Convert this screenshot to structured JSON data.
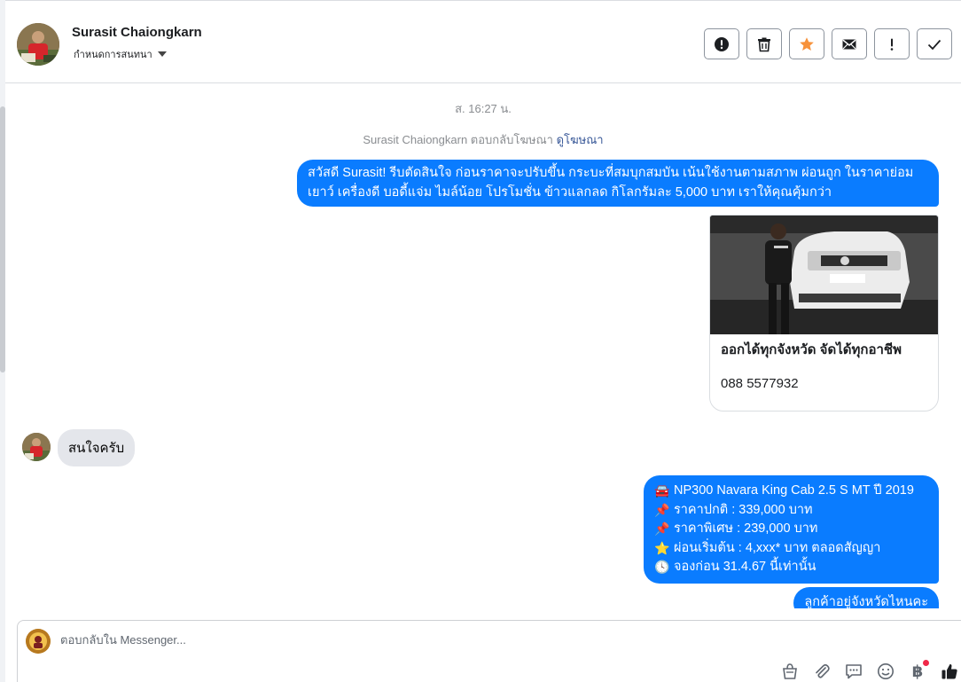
{
  "header": {
    "name": "Surasit Chaiongkarn",
    "subtitle": "กำหนดการสนทนา"
  },
  "tools": [
    {
      "icon": "alert-circle-icon"
    },
    {
      "icon": "trash-icon"
    },
    {
      "icon": "star-icon",
      "color": "#f7923b"
    },
    {
      "icon": "envelope-icon"
    },
    {
      "icon": "exclamation-icon"
    },
    {
      "icon": "checkmark-icon"
    }
  ],
  "thread": {
    "timestamp": "ส. 16:27 น.",
    "ad_reply_prefix": "Surasit Chaiongkarn ตอบกลับโฆษณา",
    "ad_reply_link": "ดูโฆษณา",
    "messages": [
      {
        "direction": "outgoing",
        "text": "สวัสดี Surasit! รีบตัดสินใจ ก่อนราคาจะปรับขึ้น กระบะที่สมบุกสมบัน เน้นใช้งานตามสภาพ ผ่อนถูก ในราคาย่อมเยาว์ เครื่องดี บอดี้แจ่ม ไมล์น้อย โปรโมชั่น ข้าวแลกลด กิโลกรัมละ 5,000 บาท เราให้คุณคุ้มกว่า"
      },
      {
        "direction": "outgoing-card",
        "card_title": "ออกได้ทุกจังหวัด จัดได้ทุกอาชีพ",
        "card_phone": "088 5577932"
      },
      {
        "direction": "incoming",
        "text": "สนใจครับ"
      },
      {
        "direction": "outgoing",
        "lines": [
          {
            "emoji": "🚘",
            "text": "NP300 Navara King Cab 2.5 S MT ปี 2019"
          },
          {
            "emoji": "📌",
            "text": "ราคาปกติ : 339,000 บาท"
          },
          {
            "emoji": "📌",
            "text": "ราคาพิเศษ : 239,000 บาท"
          },
          {
            "emoji": "⭐",
            "text": "ผ่อนเริ่มต้น : 4,xxx* บาท ตลอดสัญญา"
          },
          {
            "emoji": "🕓",
            "text": "จองก่อน 31.4.67 นี้เท่านั้น"
          }
        ]
      },
      {
        "direction": "outgoing",
        "text": "ลูกค้าอยู่จังหวัดไหนคะ"
      }
    ]
  },
  "composer": {
    "placeholder": "ตอบกลับใน Messenger...",
    "tools": [
      "shopping-bag-icon",
      "paperclip-icon",
      "chat-bubbles-icon",
      "smiley-icon",
      "baht-icon",
      "thumbs-up-icon"
    ],
    "baht_symbol": "฿",
    "accent": "#0a7cff"
  }
}
